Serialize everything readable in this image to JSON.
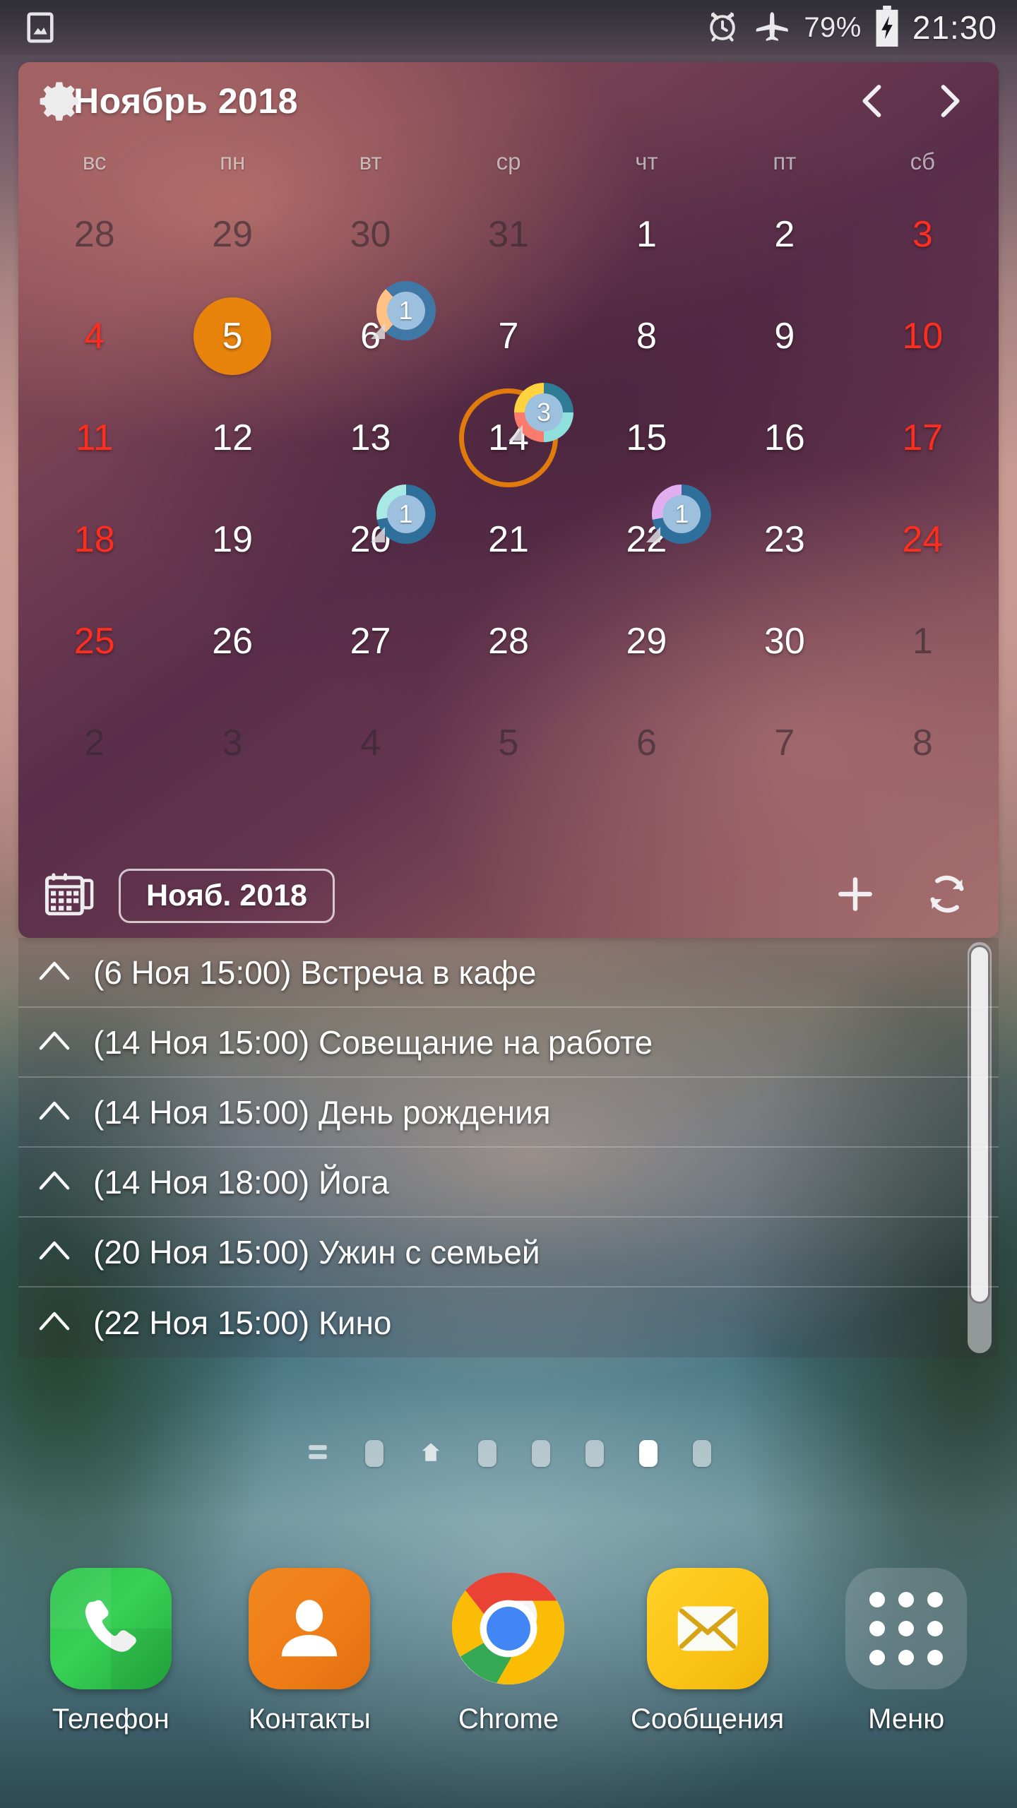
{
  "statusbar": {
    "left_icons": [
      {
        "name": "gallery-image-icon"
      }
    ],
    "alarm_icon": "alarm-clock-icon",
    "airplane_icon": "airplane-mode-icon",
    "battery_percent": "79%",
    "battery_icon": "battery-charging-icon",
    "clock": "21:30"
  },
  "widget": {
    "settings_icon": "gear-icon",
    "title": "Ноябрь 2018",
    "prev_icon": "chevron-left-icon",
    "next_icon": "chevron-right-icon",
    "weekdays": [
      "вс",
      "пн",
      "вт",
      "ср",
      "чт",
      "пт",
      "сб"
    ],
    "accent_today": "#e8840c",
    "accent_selected": "#e07a0c",
    "weekend_color": "#ff2d1e",
    "days": [
      {
        "n": "28",
        "state": "other"
      },
      {
        "n": "29",
        "state": "other"
      },
      {
        "n": "30",
        "state": "other"
      },
      {
        "n": "31",
        "state": "other"
      },
      {
        "n": "1",
        "state": "normal"
      },
      {
        "n": "2",
        "state": "normal"
      },
      {
        "n": "3",
        "state": "weekend"
      },
      {
        "n": "4",
        "state": "weekend"
      },
      {
        "n": "5",
        "state": "today"
      },
      {
        "n": "6",
        "state": "normal",
        "badge": {
          "count": "1",
          "segments": [
            {
              "color": "#3f78a6",
              "pct": 62
            },
            {
              "color": "#ffc184",
              "pct": 26
            },
            {
              "color": "#3f78a6",
              "pct": 12
            }
          ]
        }
      },
      {
        "n": "7",
        "state": "normal"
      },
      {
        "n": "8",
        "state": "normal"
      },
      {
        "n": "9",
        "state": "normal"
      },
      {
        "n": "10",
        "state": "weekend"
      },
      {
        "n": "11",
        "state": "weekend"
      },
      {
        "n": "12",
        "state": "normal"
      },
      {
        "n": "13",
        "state": "normal"
      },
      {
        "n": "14",
        "state": "selected",
        "badge": {
          "count": "3",
          "segments": [
            {
              "color": "#2e7b96",
              "pct": 25
            },
            {
              "color": "#8fe0dd",
              "pct": 25
            },
            {
              "color": "#fa7b6b",
              "pct": 25
            },
            {
              "color": "#ffd340",
              "pct": 25
            }
          ]
        }
      },
      {
        "n": "15",
        "state": "normal"
      },
      {
        "n": "16",
        "state": "normal"
      },
      {
        "n": "17",
        "state": "weekend"
      },
      {
        "n": "18",
        "state": "weekend"
      },
      {
        "n": "19",
        "state": "normal"
      },
      {
        "n": "20",
        "state": "normal",
        "badge": {
          "count": "1",
          "segments": [
            {
              "color": "#2f6f9c",
              "pct": 72
            },
            {
              "color": "#a8e9e6",
              "pct": 28
            }
          ]
        }
      },
      {
        "n": "21",
        "state": "normal"
      },
      {
        "n": "22",
        "state": "normal",
        "badge": {
          "count": "1",
          "segments": [
            {
              "color": "#2f6f9c",
              "pct": 72
            },
            {
              "color": "#e3aef0",
              "pct": 28
            }
          ]
        }
      },
      {
        "n": "23",
        "state": "normal"
      },
      {
        "n": "24",
        "state": "weekend"
      },
      {
        "n": "25",
        "state": "weekend"
      },
      {
        "n": "26",
        "state": "normal"
      },
      {
        "n": "27",
        "state": "normal"
      },
      {
        "n": "28",
        "state": "normal"
      },
      {
        "n": "29",
        "state": "normal"
      },
      {
        "n": "30",
        "state": "normal"
      },
      {
        "n": "1",
        "state": "other"
      },
      {
        "n": "2",
        "state": "other"
      },
      {
        "n": "3",
        "state": "other"
      },
      {
        "n": "4",
        "state": "other"
      },
      {
        "n": "5",
        "state": "other"
      },
      {
        "n": "6",
        "state": "other"
      },
      {
        "n": "7",
        "state": "other"
      },
      {
        "n": "8",
        "state": "other"
      }
    ],
    "footer": {
      "calendar_icon": "calendar-icon",
      "month_pill": "Нояб. 2018",
      "add_icon": "plus-icon",
      "refresh_icon": "refresh-sync-icon"
    }
  },
  "events": {
    "item_icon": "chevron-up-icon",
    "items": [
      {
        "text": "(6 Ноя 15:00) Встреча в кафе"
      },
      {
        "text": "(14 Ноя 15:00) Совещание на работе"
      },
      {
        "text": "(14 Ноя 15:00) День рождения"
      },
      {
        "text": "(14 Ноя 18:00) Йога"
      },
      {
        "text": "(20 Ноя 15:00) Ужин с семьей"
      },
      {
        "text": "(22 Ноя 15:00) Кино"
      }
    ]
  },
  "pager": {
    "pages_icon": "pages-list-icon",
    "home_icon": "home-icon",
    "dots": [
      {
        "type": "icon",
        "name": "pages-list-icon",
        "active": false
      },
      {
        "type": "dot",
        "active": false
      },
      {
        "type": "home",
        "active": false
      },
      {
        "type": "dot",
        "active": false
      },
      {
        "type": "dot",
        "active": false
      },
      {
        "type": "dot",
        "active": false
      },
      {
        "type": "dot",
        "active": true
      },
      {
        "type": "dot",
        "active": false
      }
    ]
  },
  "dock": {
    "items": [
      {
        "label": "Телефон",
        "icon": "phone-icon",
        "tile": "tile-phone"
      },
      {
        "label": "Контакты",
        "icon": "contact-person-icon",
        "tile": "tile-contacts"
      },
      {
        "label": "Chrome",
        "icon": "chrome-icon",
        "tile": "tile-chrome"
      },
      {
        "label": "Сообщения",
        "icon": "envelope-icon",
        "tile": "tile-msg"
      },
      {
        "label": "Меню",
        "icon": "app-grid-icon",
        "tile": "tile-menu"
      }
    ]
  }
}
